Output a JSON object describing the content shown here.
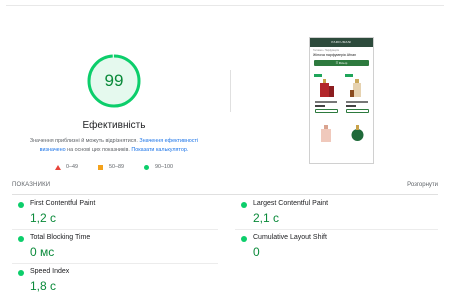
{
  "summary": {
    "score": "99",
    "score_fraction": 0.99,
    "title": "Ефективність",
    "note_text": "Значення приблизні й можуть відрізнятися. ",
    "note_link1": "Значення ефективності визначено",
    "note_text2": " на основі цих показників. ",
    "note_link2": "Показати калькулятор."
  },
  "legend": [
    {
      "range": "0–49",
      "marker": "triangle",
      "color": "#e8443a"
    },
    {
      "range": "50–89",
      "marker": "square",
      "color": "#f4a21b"
    },
    {
      "range": "90–100",
      "marker": "circle",
      "color": "#0cce6b"
    }
  ],
  "preview": {
    "brand": "PARFUMANI",
    "breadcrumb": "Головна › Парфумерія",
    "heading": "Жіноча парфумерія Afnan",
    "filter_label": "☰ Фільтр"
  },
  "metrics_section": {
    "heading": "ПОКАЗНИКИ",
    "expand_label": "Розгорнути"
  },
  "metrics": [
    {
      "name": "First Contentful Paint",
      "value": "1,2 с",
      "status_color": "#0cce6b"
    },
    {
      "name": "Largest Contentful Paint",
      "value": "2,1 с",
      "status_color": "#0cce6b"
    },
    {
      "name": "Total Blocking Time",
      "value": "0 мс",
      "status_color": "#0cce6b"
    },
    {
      "name": "Cumulative Layout Shift",
      "value": "0",
      "status_color": "#0cce6b"
    },
    {
      "name": "Speed Index",
      "value": "1,8 с",
      "status_color": "#0cce6b"
    }
  ],
  "colors": {
    "pass_green": "#0cce6b",
    "score_text": "#0a8a3a",
    "link_blue": "#1a73e8"
  }
}
